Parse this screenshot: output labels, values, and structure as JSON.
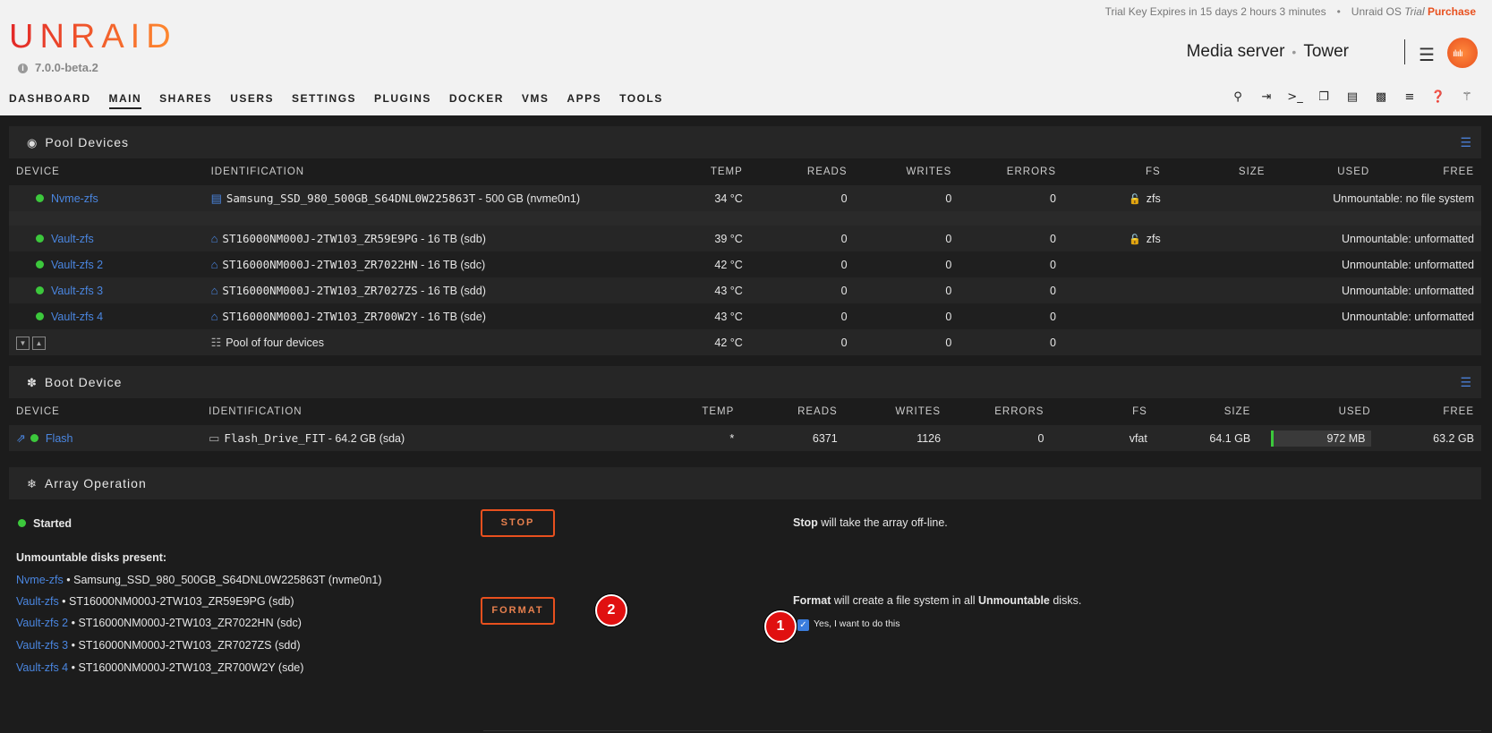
{
  "header": {
    "trial_text": "Trial Key Expires in 15 days 2 hours 3 minutes",
    "trial_sep": "•",
    "os_label": "Unraid OS",
    "os_trial": "Trial",
    "purchase": "Purchase",
    "logo": "UNRAID",
    "version": "7.0.0-beta.2",
    "server_desc": "Media server",
    "server_sep": "•",
    "server_name": "Tower"
  },
  "nav": {
    "items": [
      "DASHBOARD",
      "MAIN",
      "SHARES",
      "USERS",
      "SETTINGS",
      "PLUGINS",
      "DOCKER",
      "VMS",
      "APPS",
      "TOOLS"
    ],
    "active": "MAIN"
  },
  "toolbar_icons": [
    "search-icon",
    "logout-icon",
    "terminal-icon",
    "copy-icon",
    "feedback-icon",
    "display-icon",
    "log-icon",
    "help-icon",
    "bell-icon"
  ],
  "columns": {
    "device": "DEVICE",
    "identification": "IDENTIFICATION",
    "temp": "TEMP",
    "reads": "READS",
    "writes": "WRITES",
    "errors": "ERRORS",
    "fs": "FS",
    "size": "SIZE",
    "used": "USED",
    "free": "FREE"
  },
  "pool": {
    "title": "Pool Devices",
    "rows": [
      {
        "device": "Nvme-zfs",
        "id": "Samsung_SSD_980_500GB_S64DNL0W225863T",
        "id_suffix": " - 500 GB (nvme0n1)",
        "temp": "34 °C",
        "reads": "0",
        "writes": "0",
        "errors": "0",
        "fs": "zfs",
        "status": "Unmountable: no file system"
      },
      {
        "device": "Vault-zfs",
        "id": "ST16000NM000J-2TW103_ZR59E9PG",
        "id_suffix": " - 16 TB (sdb)",
        "temp": "39 °C",
        "reads": "0",
        "writes": "0",
        "errors": "0",
        "fs": "zfs",
        "status": "Unmountable: unformatted"
      },
      {
        "device": "Vault-zfs 2",
        "id": "ST16000NM000J-2TW103_ZR7022HN",
        "id_suffix": " - 16 TB (sdc)",
        "temp": "42 °C",
        "reads": "0",
        "writes": "0",
        "errors": "0",
        "fs": "",
        "status": "Unmountable: unformatted"
      },
      {
        "device": "Vault-zfs 3",
        "id": "ST16000NM000J-2TW103_ZR7027ZS",
        "id_suffix": " - 16 TB (sdd)",
        "temp": "43 °C",
        "reads": "0",
        "writes": "0",
        "errors": "0",
        "fs": "",
        "status": "Unmountable: unformatted"
      },
      {
        "device": "Vault-zfs 4",
        "id": "ST16000NM000J-2TW103_ZR700W2Y",
        "id_suffix": " - 16 TB (sde)",
        "temp": "43 °C",
        "reads": "0",
        "writes": "0",
        "errors": "0",
        "fs": "",
        "status": "Unmountable: unformatted"
      }
    ],
    "summary": {
      "label": "Pool of four devices",
      "temp": "42 °C",
      "reads": "0",
      "writes": "0",
      "errors": "0"
    }
  },
  "boot": {
    "title": "Boot Device",
    "row": {
      "device": "Flash",
      "id": "Flash_Drive_FIT",
      "id_suffix": " - 64.2 GB (sda)",
      "temp": "*",
      "reads": "6371",
      "writes": "1126",
      "errors": "0",
      "fs": "vfat",
      "size": "64.1 GB",
      "used": "972 MB",
      "used_fraction": 0.015,
      "free": "63.2 GB"
    }
  },
  "array": {
    "title": "Array Operation",
    "status": "Started",
    "stop_button": "STOP",
    "stop_bold": "Stop",
    "stop_desc": " will take the array off-line.",
    "unmountable_heading": "Unmountable disks present:",
    "unmountable": [
      {
        "name": "Nvme-zfs",
        "detail": " • Samsung_SSD_980_500GB_S64DNL0W225863T (nvme0n1)"
      },
      {
        "name": "Vault-zfs",
        "detail": " • ST16000NM000J-2TW103_ZR59E9PG (sdb)"
      },
      {
        "name": "Vault-zfs 2",
        "detail": " • ST16000NM000J-2TW103_ZR7022HN (sdc)"
      },
      {
        "name": "Vault-zfs 3",
        "detail": " • ST16000NM000J-2TW103_ZR7027ZS (sdd)"
      },
      {
        "name": "Vault-zfs 4",
        "detail": " • ST16000NM000J-2TW103_ZR700W2Y (sde)"
      }
    ],
    "format_button": "FORMAT",
    "format_bold": "Format",
    "format_desc_1": " will create a file system in all ",
    "format_bold_2": "Unmountable",
    "format_desc_2": " disks.",
    "confirm_label": "Yes, I want to do this",
    "confirm_checked": true,
    "badge_1": "1",
    "badge_2": "2"
  },
  "colors": {
    "accent": "#e8501e",
    "link": "#4a86e0",
    "ok": "#3cc83c",
    "badge": "#e01010"
  }
}
